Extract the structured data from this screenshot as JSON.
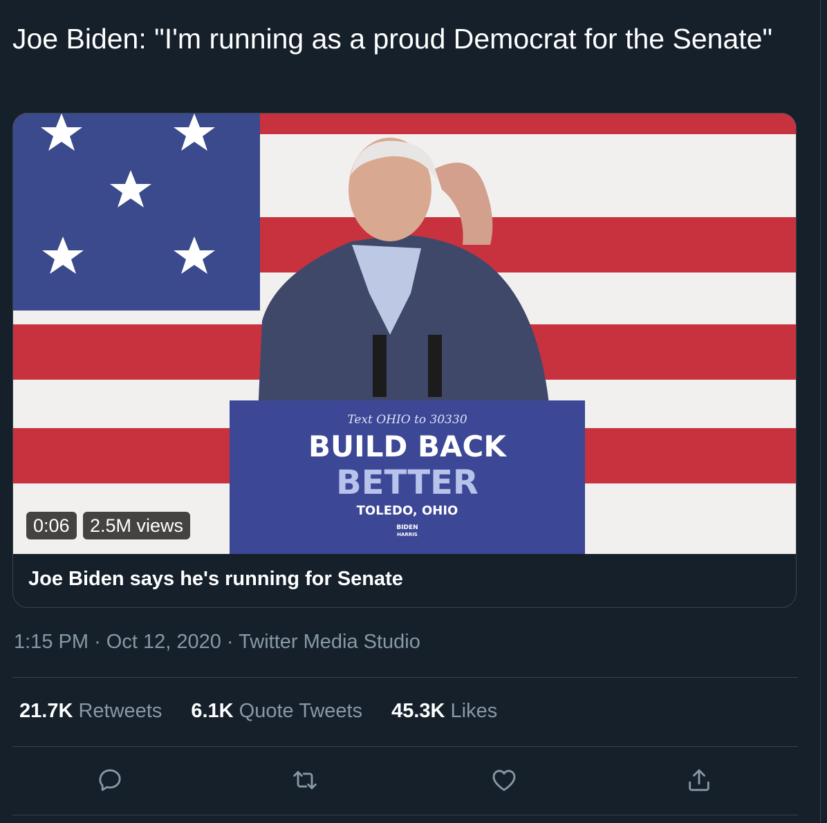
{
  "tweet": {
    "text": "Joe Biden: \"I'm running as a proud Democrat for the Senate\""
  },
  "media": {
    "duration": "0:06",
    "views": "2.5M views",
    "caption": "Joe Biden says he's running for Senate",
    "podium": {
      "line1": "Text OHIO to 30330",
      "line2": "BUILD BACK",
      "line3": "BETTER",
      "line4": "TOLEDO, OHIO",
      "logo_top": "BIDEN",
      "logo_bottom": "HARRIS"
    }
  },
  "meta": {
    "time": "1:15 PM",
    "date": "Oct 12, 2020",
    "source": "Twitter Media Studio",
    "sep": "·"
  },
  "stats": {
    "retweets_count": "21.7K",
    "retweets_label": "Retweets",
    "quotes_count": "6.1K",
    "quotes_label": "Quote Tweets",
    "likes_count": "45.3K",
    "likes_label": "Likes"
  },
  "icons": [
    "reply-icon",
    "retweet-icon",
    "like-icon",
    "share-icon"
  ],
  "colors": {
    "background": "#15202b",
    "border": "#38444d",
    "secondary_text": "#8899a6",
    "flag_red": "#c8323f",
    "flag_blue": "#3a4a8c",
    "podium_blue": "#3c4796"
  }
}
